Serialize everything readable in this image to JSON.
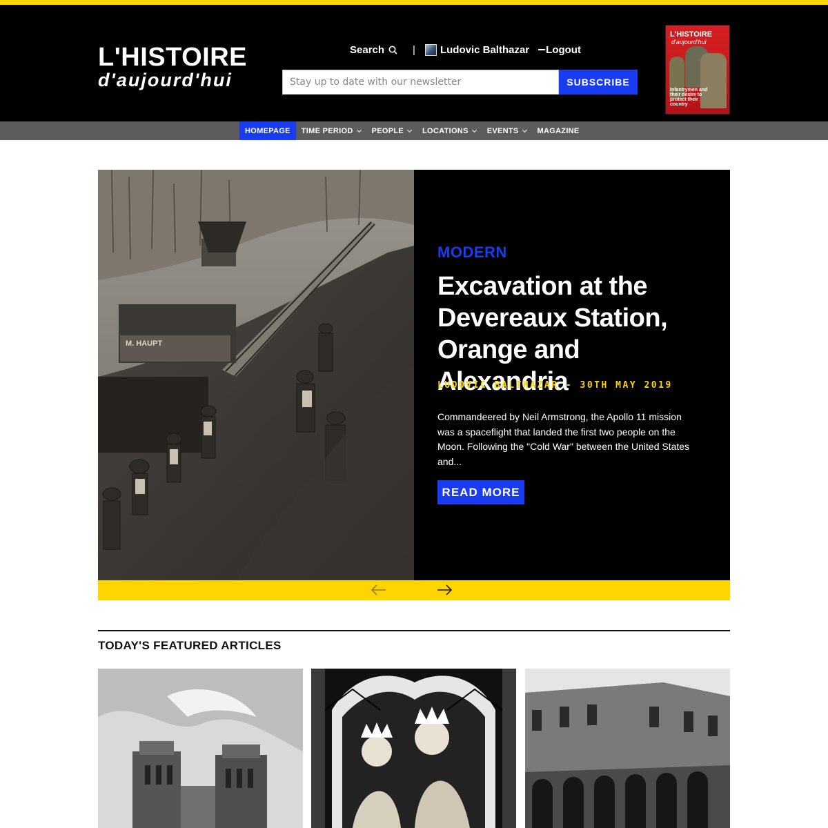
{
  "brand": {
    "logo_line1": "L'HISTOIRE",
    "logo_line2": "d'aujourd'hui",
    "accent_color": "#ffd500",
    "primary_color": "#1a3cf0"
  },
  "header": {
    "search_label": "Search",
    "separator": "|",
    "user_name": "Ludovic Balthazar",
    "logout_label": "Logout",
    "newsletter_placeholder": "Stay up to date with our newsletter",
    "subscribe_label": "SUBSCRIBE"
  },
  "magazine": {
    "title": "L'HISTOIRE",
    "subtitle": "d'aujourd'hui",
    "headline": "Infantrymen and their desire to protect their country"
  },
  "nav": {
    "items": [
      {
        "label": "HOMEPAGE",
        "active": true,
        "dropdown": false
      },
      {
        "label": "TIME PERIOD",
        "active": false,
        "dropdown": true
      },
      {
        "label": "PEOPLE",
        "active": false,
        "dropdown": true
      },
      {
        "label": "LOCATIONS",
        "active": false,
        "dropdown": true
      },
      {
        "label": "EVENTS",
        "active": false,
        "dropdown": true
      },
      {
        "label": "MAGAZINE",
        "active": false,
        "dropdown": false
      }
    ]
  },
  "hero": {
    "category": "MODERN",
    "title": "Excavation at the Devereaux Station, Orange and Alexandria",
    "meta": "LUDOVIC BALTHAZAR - 30TH MAY 2019",
    "excerpt": "Commandeered by Neil Armstrong, the Apollo 11 mission was a spaceflight that landed the first two people on the Moon. Following the \"Cold War\" between the United States and...",
    "cta_label": "READ MORE",
    "image_caption_text": "M. HAUPT"
  },
  "featured": {
    "section_title": "TODAY'S FEATURED ARTICLES"
  }
}
